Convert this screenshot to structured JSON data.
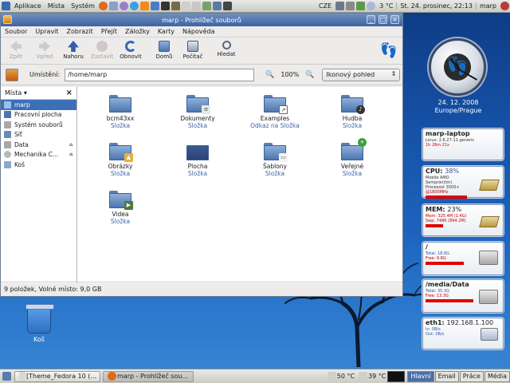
{
  "top_panel": {
    "menus": [
      "Aplikace",
      "Místa",
      "Systém"
    ],
    "keyboard_layout": "CZE",
    "temperature": "3 °C",
    "datetime": "St. 24. prosinec, 22:13",
    "user": "marp"
  },
  "desktop": {
    "trash_label": "Koš"
  },
  "clock": {
    "date": "24. 12. 2008",
    "timezone": "Europe/Prague"
  },
  "conky": {
    "host": {
      "title": "marp-laptop",
      "kernel": "Linux: 2.6.27-11-generic",
      "uptime": "1h 26m 21s"
    },
    "cpu": {
      "title": "CPU:",
      "usage": "38%",
      "model": "Mobile AMD Sempron(tm) Processor 3500+",
      "freq": "@1800MHz"
    },
    "mem": {
      "title": "MEM:",
      "usage": "23%",
      "mem_line": "Mem: 325.4M (1.4G)",
      "swap_line": "Swp: 748K (894.2M)"
    },
    "root": {
      "title": "/",
      "total": "Total: 18.8G",
      "free": "Free: 9.8G"
    },
    "data": {
      "title": "/media/Data",
      "total": "Total: 35.3G",
      "free": "Free: 13.3G"
    },
    "net": {
      "title": "eth1:",
      "ip": "192.168.1.100",
      "in": "In:  0B/s",
      "out": "Out: 0B/s"
    }
  },
  "window": {
    "title": "marp - Prohlížeč souborů",
    "menu": [
      "Soubor",
      "Upravit",
      "Zobrazit",
      "Přejít",
      "Záložky",
      "Karty",
      "Nápověda"
    ],
    "toolbar": {
      "back": "Zpět",
      "forward": "Vpřed",
      "up": "Nahoru",
      "stop": "Zastavit",
      "reload": "Obnovit",
      "home": "Domů",
      "computer": "Počítač",
      "search": "Hledat"
    },
    "location": {
      "label": "Umístění:",
      "path": "/home/marp",
      "zoom": "100%",
      "view": "Ikonový pohled"
    },
    "sidebar": {
      "header": "Místa",
      "items": [
        "marp",
        "Pracovní plocha",
        "Systém souborů",
        "Síť",
        "Data",
        "Mechanika C...",
        "Koš"
      ]
    },
    "files": [
      {
        "name": "bcm43xx",
        "kind": "Složka",
        "emblem": ""
      },
      {
        "name": "Dokumenty",
        "kind": "Složka",
        "emblem": "doc"
      },
      {
        "name": "Examples",
        "kind": "Odkaz na Složka",
        "emblem": "link"
      },
      {
        "name": "Hudba",
        "kind": "Složka",
        "emblem": "music"
      },
      {
        "name": "Obrázky",
        "kind": "Složka",
        "emblem": "image"
      },
      {
        "name": "Plocha",
        "kind": "Složka",
        "emblem": "desktop"
      },
      {
        "name": "Šablony",
        "kind": "Složka",
        "emblem": "template"
      },
      {
        "name": "Veřejné",
        "kind": "Složka",
        "emblem": "share"
      },
      {
        "name": "Videa",
        "kind": "Složka",
        "emblem": "video"
      }
    ],
    "status": "9 položek, Volné místo: 9,0 GB"
  },
  "bottom_panel": {
    "tasks": [
      "[Theme_Fedora 10 (...",
      "marp - Prohlížeč sou..."
    ],
    "temp1": "50 °C",
    "temp2": "39 °C",
    "workspaces": [
      "Hlavní",
      "Email",
      "Práce",
      "Média"
    ]
  }
}
